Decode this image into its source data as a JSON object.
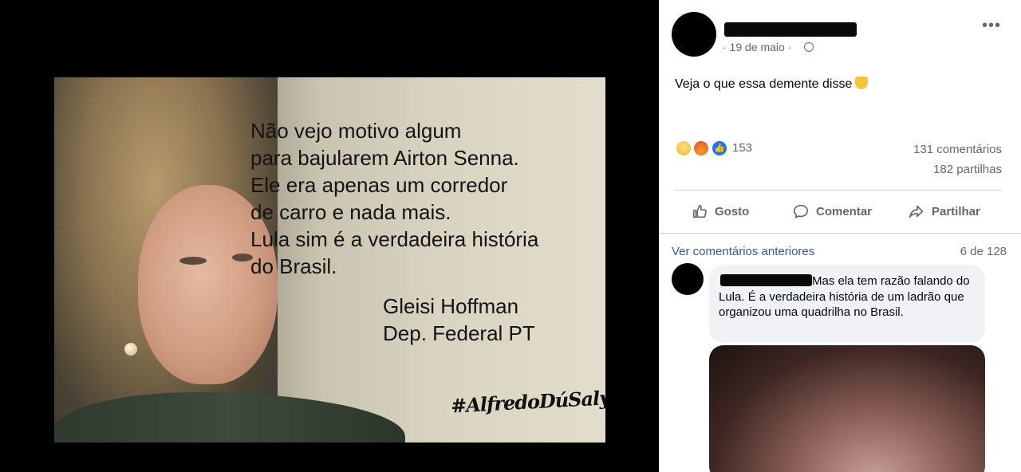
{
  "meme": {
    "quote_lines": [
      "Não vejo motivo algum",
      "para  bajularem Airton Senna.",
      "Ele era apenas um corredor",
      "de carro e nada mais.",
      "Lula sim é a verdadeira história",
      "do Brasil."
    ],
    "author_name": "Gleisi Hoffman",
    "author_title": "Dep. Federal PT",
    "signature": "#AlfredoDúSalyn"
  },
  "post": {
    "date": "· 19 de maio ·",
    "more_label": "•••",
    "text": "Veja o que essa demente disse",
    "reaction_count": "153",
    "comments_count": "131 comentários",
    "shares_count": "182 partilhas"
  },
  "actions": {
    "like": "Gosto",
    "comment": "Comentar",
    "share": "Partilhar"
  },
  "comments": {
    "prev_label": "Ver comentários anteriores",
    "pager": "6 de 128",
    "items": [
      {
        "text": "Mas ela tem razão falando do Lula. É a verdadeira história de um ladrão que organizou uma quadrilha no Brasil."
      }
    ]
  }
}
